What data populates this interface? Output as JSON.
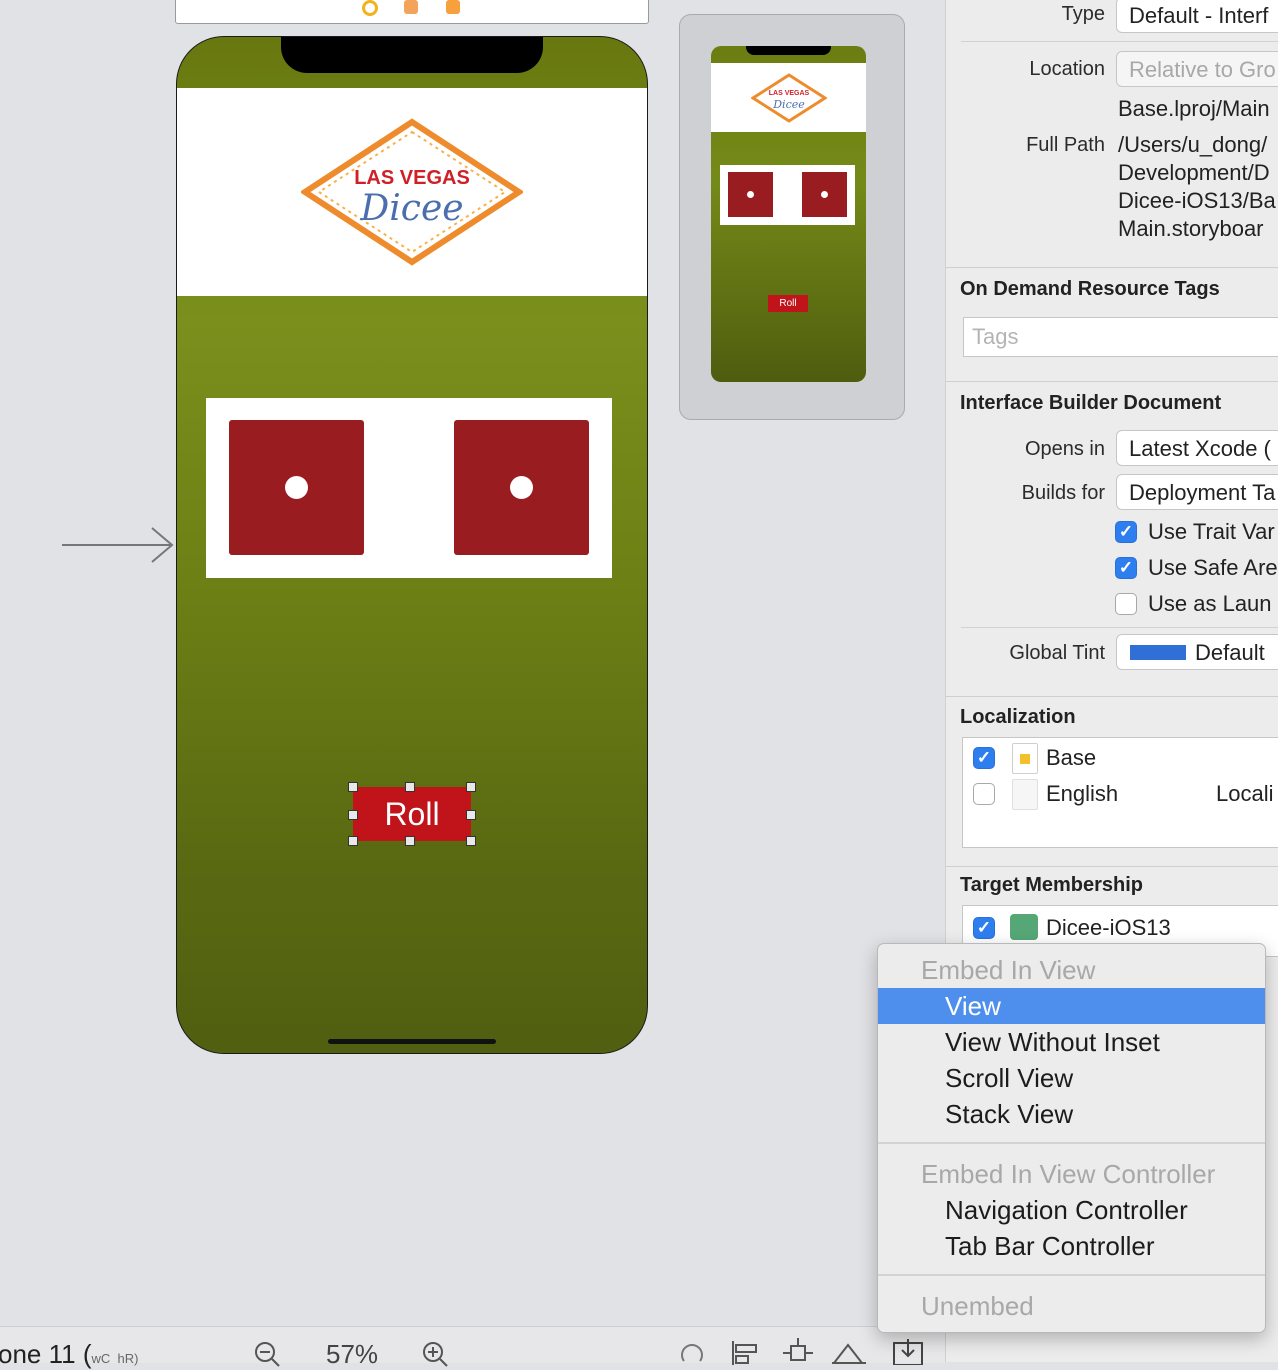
{
  "canvas": {
    "roll_label": "Roll",
    "logo_line1": "LAS VEGAS",
    "logo_line2": "Dicee",
    "mini_roll_label": "Roll"
  },
  "inspector": {
    "type_label": "Type",
    "type_value": "Default - Interf",
    "location_label": "Location",
    "location_value": "Relative to Gro",
    "location_path": "Base.lproj/Main",
    "full_path_label": "Full Path",
    "full_path_lines": [
      "/Users/u_dong/",
      "Development/D",
      "Dicee-iOS13/Ba",
      "Main.storyboar"
    ],
    "on_demand_title": "On Demand Resource Tags",
    "tags_placeholder": "Tags",
    "ib_doc_title": "Interface Builder Document",
    "opens_in_label": "Opens in",
    "opens_in_value": "Latest Xcode (",
    "builds_for_label": "Builds for",
    "builds_for_value": "Deployment Ta",
    "use_trait": "Use Trait Var",
    "use_safe": "Use Safe Are",
    "use_launch": "Use as Laun",
    "global_tint_label": "Global Tint",
    "global_tint_value": "Default",
    "global_tint_color": "#2f6fd6",
    "localization_title": "Localization",
    "loc_base": "Base",
    "loc_english": "English",
    "loc_english_right": "Locali",
    "target_title": "Target Membership",
    "target_name": "Dicee-iOS13"
  },
  "bottom_bar": {
    "device": "one 11 (",
    "size_w": "wC",
    "size_h": "hR)",
    "zoom": "57%"
  },
  "menu": {
    "embed_in_view": "Embed In View",
    "view": "View",
    "view_without_inset": "View Without Inset",
    "scroll_view": "Scroll View",
    "stack_view": "Stack View",
    "embed_in_vc": "Embed In View Controller",
    "navigation_controller": "Navigation Controller",
    "tab_bar_controller": "Tab Bar Controller",
    "unembed": "Unembed"
  }
}
